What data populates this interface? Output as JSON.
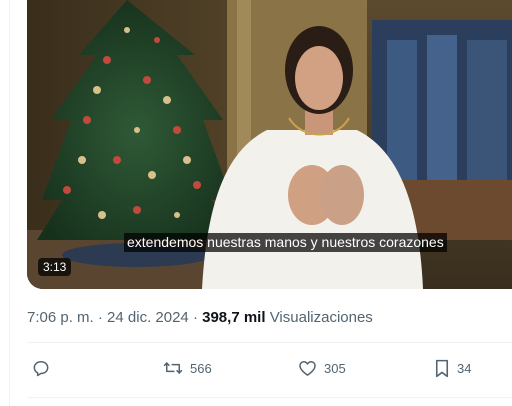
{
  "video": {
    "caption": "extendemos nuestras manos y nuestros corazones",
    "duration": "3:13"
  },
  "meta": {
    "time": "7:06 p. m.",
    "separator1": " · ",
    "date": "24 dic. 2024",
    "separator2": " · ",
    "views_count": "398,7 mil",
    "views_label": "Visualizaciones"
  },
  "actions": {
    "reply": {
      "icon": "reply-icon",
      "count": ""
    },
    "repost": {
      "icon": "repost-icon",
      "count": "566"
    },
    "like": {
      "icon": "heart-icon",
      "count": "305"
    },
    "bookmark": {
      "icon": "bookmark-icon",
      "count": "34"
    }
  },
  "colors": {
    "secondary_text": "#536471",
    "primary_text": "#0f1419",
    "divider": "#eff3f4"
  }
}
